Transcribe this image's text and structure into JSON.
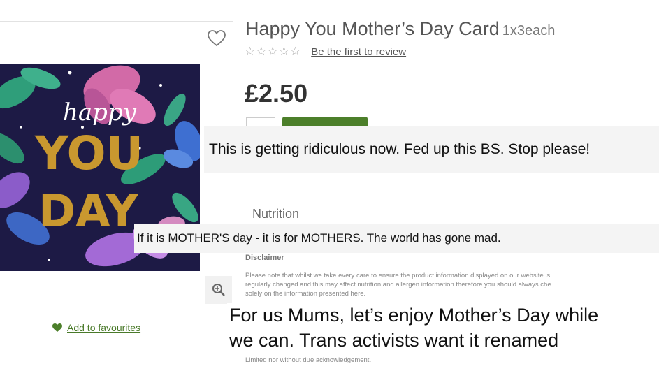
{
  "product": {
    "title": "Happy You Mother’s Day Card",
    "pack_size": "1x3each",
    "price": "£2.50",
    "rating_stars": "☆☆☆☆☆",
    "review_link": "Be the first to review",
    "add_to_favourites": "Add to favourites",
    "card_text": {
      "script_word": "happy",
      "word_you": "YOU",
      "word_day": "DAY"
    },
    "icons": {
      "wishlist": "heart-outline-icon",
      "zoom": "magnifier-plus-icon",
      "favourite": "heart-filled-icon"
    }
  },
  "sections": {
    "nutrition": "Nutrition",
    "disclaimer_heading": "Disclaimer",
    "disclaimer_line1": "Please note that whilst we take every care to ensure the product information displayed on our website is",
    "disclaimer_line2": "regularly changed and this may affect nutrition and allergen information therefore you should always che",
    "disclaimer_line3": "solely on the information presented here.",
    "disclaimer_footer": "Limited nor without due acknowledgement."
  },
  "overlays": {
    "comment_1": "This is getting ridiculous now. Fed up this BS. Stop please!",
    "comment_2": "If it is MOTHER'S day - it is for MOTHERS. The world has gone mad.",
    "comment_3_line1": "For us Mums, let’s enjoy Mother’s Day while",
    "comment_3_line2": "we can. Trans activists want it renamed"
  },
  "colors": {
    "brand_green": "#4c7f2a",
    "card_background": "#1d1a45",
    "gold": "#c9982f"
  }
}
